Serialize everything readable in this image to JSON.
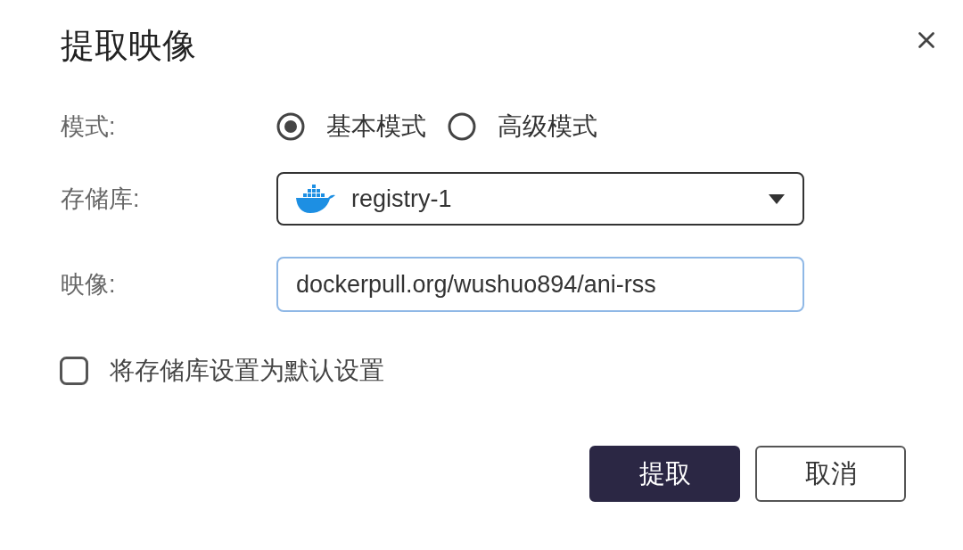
{
  "dialog": {
    "title": "提取映像"
  },
  "mode": {
    "label": "模式:",
    "options": [
      {
        "label": "基本模式",
        "selected": true
      },
      {
        "label": "高级模式",
        "selected": false
      }
    ]
  },
  "repository": {
    "label": "存储库:",
    "value": "registry-1"
  },
  "image": {
    "label": "映像:",
    "value": "dockerpull.org/wushuo894/ani-rss",
    "focused": true
  },
  "set_default": {
    "label": "将存储库设置为默认设置",
    "checked": false
  },
  "buttons": [
    {
      "label": "提取",
      "kind": "primary"
    },
    {
      "label": "取消",
      "kind": "secondary"
    }
  ]
}
